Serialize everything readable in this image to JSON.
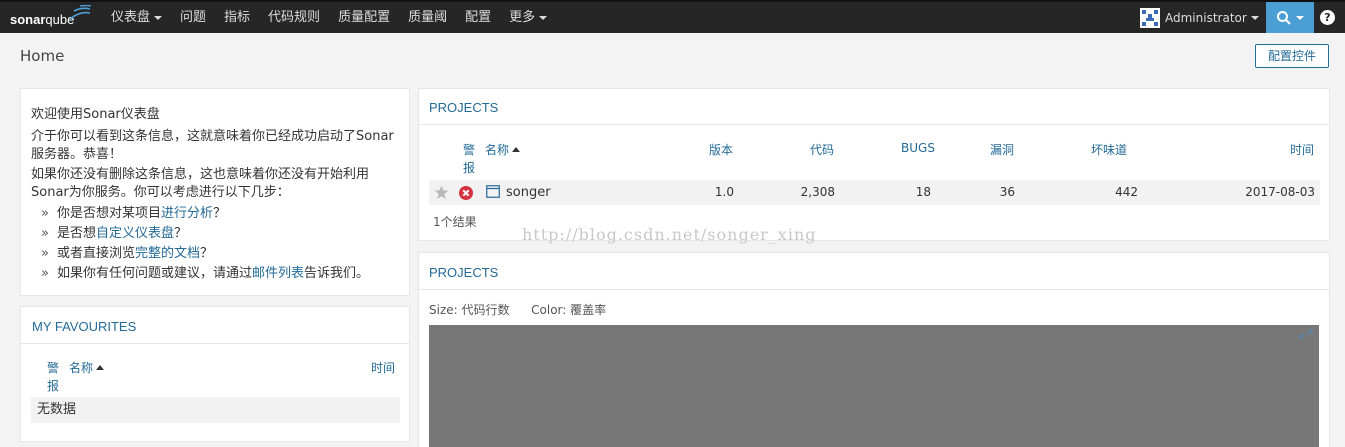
{
  "navbar": {
    "logo_sonar": "sonar",
    "logo_qube": "qube",
    "items": [
      {
        "label": "仪表盘",
        "dropdown": true
      },
      {
        "label": "问题",
        "dropdown": false
      },
      {
        "label": "指标",
        "dropdown": false
      },
      {
        "label": "代码规则",
        "dropdown": false
      },
      {
        "label": "质量配置",
        "dropdown": false
      },
      {
        "label": "质量阈",
        "dropdown": false
      },
      {
        "label": "配置",
        "dropdown": false
      },
      {
        "label": "更多",
        "dropdown": true
      }
    ],
    "user": "Administrator",
    "help": "?",
    "search_icon": "search-icon",
    "accent": "#4b9fd5"
  },
  "page": {
    "title": "Home",
    "config_button": "配置控件"
  },
  "welcome": {
    "title": "欢迎使用Sonar仪表盘",
    "p1": "介于你可以看到这条信息，这就意味着你已经成功启动了Sonar服务器。恭喜！",
    "p2": "如果你还没有删除这条信息，这也意味着你还没有开始利用Sonar为你服务。你可以考虑进行以下几步：",
    "bullet": "»",
    "items": [
      {
        "pre": "你是否想对某项目",
        "link": "进行分析",
        "post": "？"
      },
      {
        "pre": "是否想",
        "link": "自定义仪表盘",
        "post": "？"
      },
      {
        "pre": "或者直接浏览",
        "link": "完整的文档",
        "post": "？"
      },
      {
        "pre": "如果你有任何问题或建议，请通过",
        "link": "邮件列表",
        "post": "告诉我们。"
      }
    ]
  },
  "favourites": {
    "title": "MY FAVOURITES",
    "col_alert": "警报",
    "col_name": "名称",
    "col_time": "时间",
    "empty": "无数据"
  },
  "projects": {
    "title": "PROJECTS",
    "columns": {
      "alert": "警报",
      "name": "名称",
      "version": "版本",
      "code": "代码",
      "bugs": "BUGS",
      "vulnerabilities": "漏洞",
      "code_smells": "坏味道",
      "time": "时间"
    },
    "rows": [
      {
        "name": "songer",
        "version": "1.0",
        "code": "2,308",
        "bugs": "18",
        "vulnerabilities": "36",
        "code_smells": "442",
        "time": "2017-08-03",
        "status": "error",
        "status_color": "#d4333f"
      }
    ],
    "result_count": "1个结果"
  },
  "treemap": {
    "title": "PROJECTS",
    "size_label": "Size: 代码行数",
    "color_label": "Color: 覆盖率"
  },
  "watermark": "http://blog.csdn.net/songer_xing"
}
